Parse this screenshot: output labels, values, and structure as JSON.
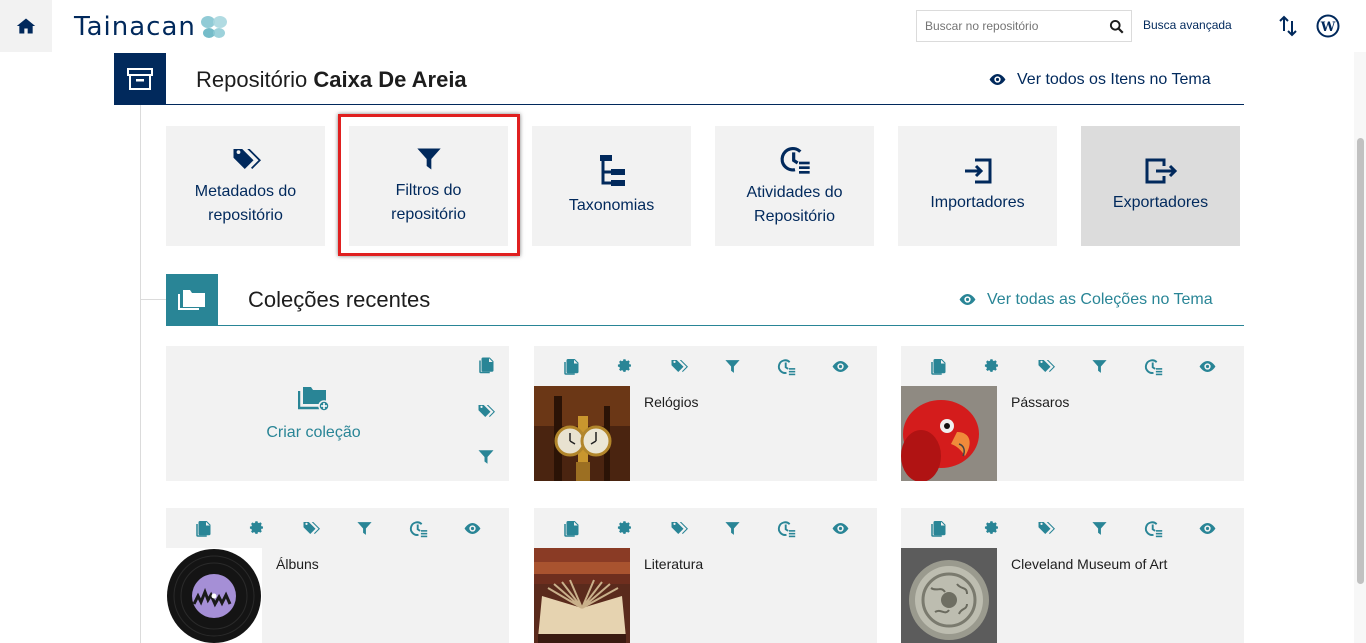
{
  "topbar": {
    "logo_text": "Tainacan",
    "search_placeholder": "Buscar no repositório",
    "advanced_search": "Busca avançada"
  },
  "repository": {
    "title_prefix": "Repositório ",
    "title_name": "Caixa De Areia",
    "view_all_items": "Ver todos os Itens no Tema"
  },
  "tiles": [
    {
      "label": "Metadados do repositório",
      "icon": "tags-icon"
    },
    {
      "label": "Filtros do repositório",
      "icon": "filter-icon",
      "highlighted": true
    },
    {
      "label": "Taxonomias",
      "icon": "taxonomy-icon"
    },
    {
      "label": "Atividades do Repositório",
      "icon": "activities-icon"
    },
    {
      "label": "Importadores",
      "icon": "importer-icon"
    },
    {
      "label": "Exportadores",
      "icon": "exporter-icon",
      "active": true
    }
  ],
  "collections_section": {
    "title": "Coleções recentes",
    "view_all": "Ver todas as Coleções no Tema",
    "create_label": "Criar coleção"
  },
  "collections": [
    {
      "name": "Relógios",
      "thumb": "clock"
    },
    {
      "name": "Pássaros",
      "thumb": "parrot"
    },
    {
      "name": "Álbuns",
      "thumb": "vinyl"
    },
    {
      "name": "Literatura",
      "thumb": "book"
    },
    {
      "name": "Cleveland Museum of Art",
      "thumb": "mirror"
    }
  ],
  "colors": {
    "primary": "#01295c",
    "accent": "#298596",
    "tile_bg": "#f2f2f2",
    "highlight": "#e02020"
  }
}
